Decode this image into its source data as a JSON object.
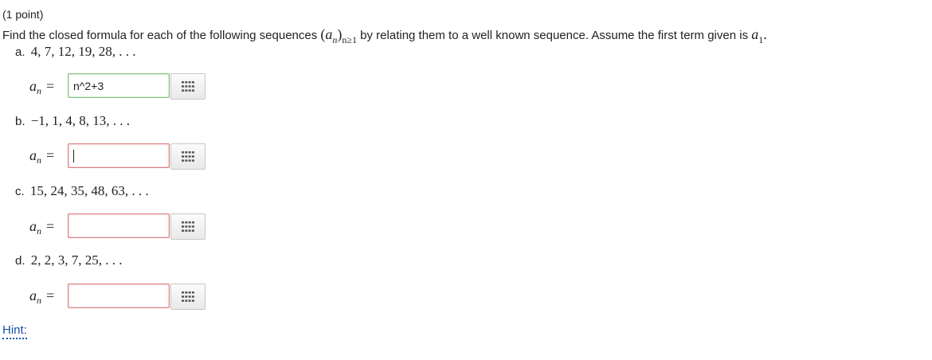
{
  "header": {
    "points": "(1 point)"
  },
  "prompt": {
    "text_before": "Find the closed formula for each of the following sequences",
    "seq_a": "a",
    "seq_n": "n",
    "seq_sub": "n≥1",
    "text_middle": "by relating them to a well known sequence. Assume the first term given is",
    "first_a": "a",
    "first_sub": "1",
    "text_end": "."
  },
  "lhs": {
    "a": "a",
    "n": "n",
    "eq": "="
  },
  "questions": [
    {
      "label": "a.",
      "sequence": "4, 7, 12, 19, 28, . . .",
      "answer_value": "n^2+3",
      "status": "correct"
    },
    {
      "label": "b.",
      "sequence": "−1, 1, 4, 8, 13, . . .",
      "answer_value": "",
      "status": "incorrect"
    },
    {
      "label": "c.",
      "sequence": "15, 24, 35, 48, 63, . . .",
      "answer_value": "",
      "status": "incorrect"
    },
    {
      "label": "d.",
      "sequence": "2, 2, 3, 7, 25, . . .",
      "answer_value": "",
      "status": "incorrect"
    }
  ],
  "equation_editor_icon": "grid-icon",
  "hint_label": "Hint:",
  "colors": {
    "correct_border": "#7fc27f",
    "incorrect_border": "#d98080",
    "link": "#1a4fa8",
    "icon": "#555555"
  }
}
